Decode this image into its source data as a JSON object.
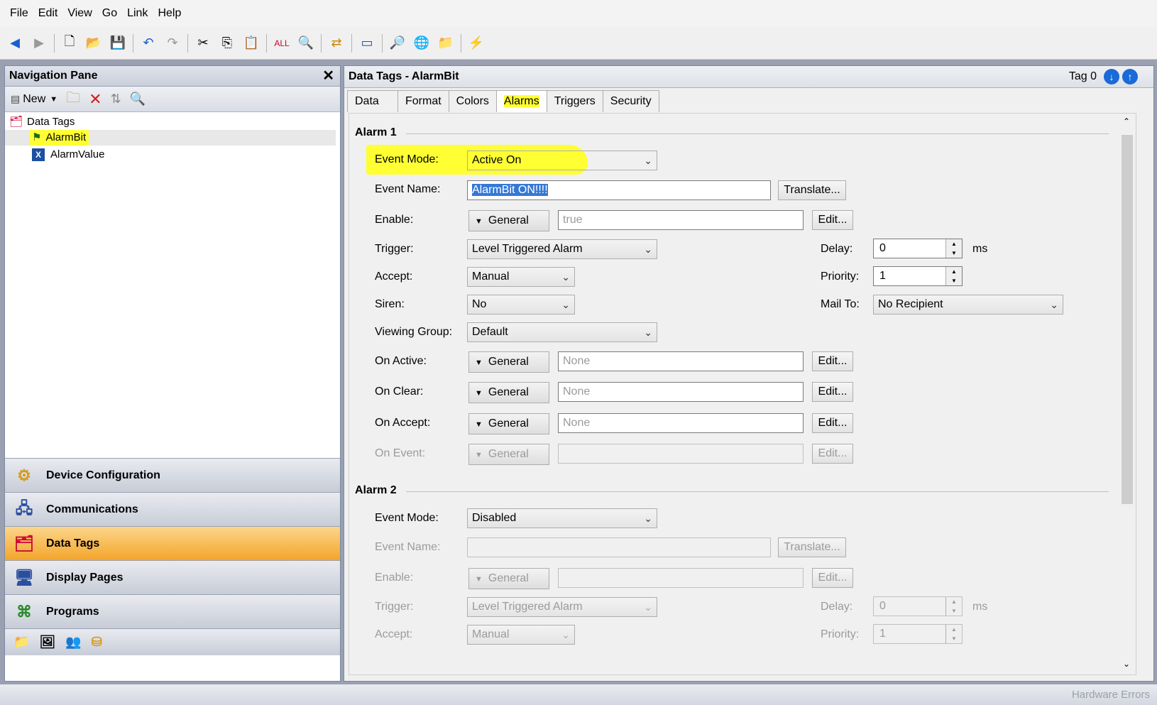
{
  "menu": [
    "File",
    "Edit",
    "View",
    "Go",
    "Link",
    "Help"
  ],
  "nav": {
    "title": "Navigation Pane",
    "new_label": "New",
    "tree_root": "Data Tags",
    "tree_items": [
      "AlarmBit",
      "AlarmValue"
    ],
    "sections": [
      "Device Configuration",
      "Communications",
      "Data Tags",
      "Display Pages",
      "Programs"
    ]
  },
  "content": {
    "title": "Data Tags - AlarmBit",
    "tag_label": "Tag 0",
    "tabs": [
      "Data",
      "Format",
      "Colors",
      "Alarms",
      "Triggers",
      "Security"
    ],
    "active_tab": "Alarms"
  },
  "alarm1": {
    "header": "Alarm 1",
    "event_mode_label": "Event Mode:",
    "event_mode": "Active On",
    "event_name_label": "Event Name:",
    "event_name": "AlarmBit ON!!!!",
    "translate": "Translate...",
    "enable_label": "Enable:",
    "general": "General",
    "enable_value": "true",
    "edit": "Edit...",
    "trigger_label": "Trigger:",
    "trigger": "Level Triggered Alarm",
    "delay_label": "Delay:",
    "delay": "0",
    "ms": "ms",
    "accept_label": "Accept:",
    "accept": "Manual",
    "priority_label": "Priority:",
    "priority": "1",
    "siren_label": "Siren:",
    "siren": "No",
    "mailto_label": "Mail To:",
    "mailto": "No Recipient",
    "viewing_group_label": "Viewing Group:",
    "viewing_group": "Default",
    "on_active_label": "On Active:",
    "on_clear_label": "On Clear:",
    "on_accept_label": "On Accept:",
    "on_event_label": "On Event:",
    "none": "None"
  },
  "alarm2": {
    "header": "Alarm 2",
    "event_mode": "Disabled",
    "trigger": "Level Triggered Alarm",
    "delay": "0",
    "accept": "Manual",
    "priority": "1"
  },
  "status": {
    "right": "Hardware Errors"
  }
}
